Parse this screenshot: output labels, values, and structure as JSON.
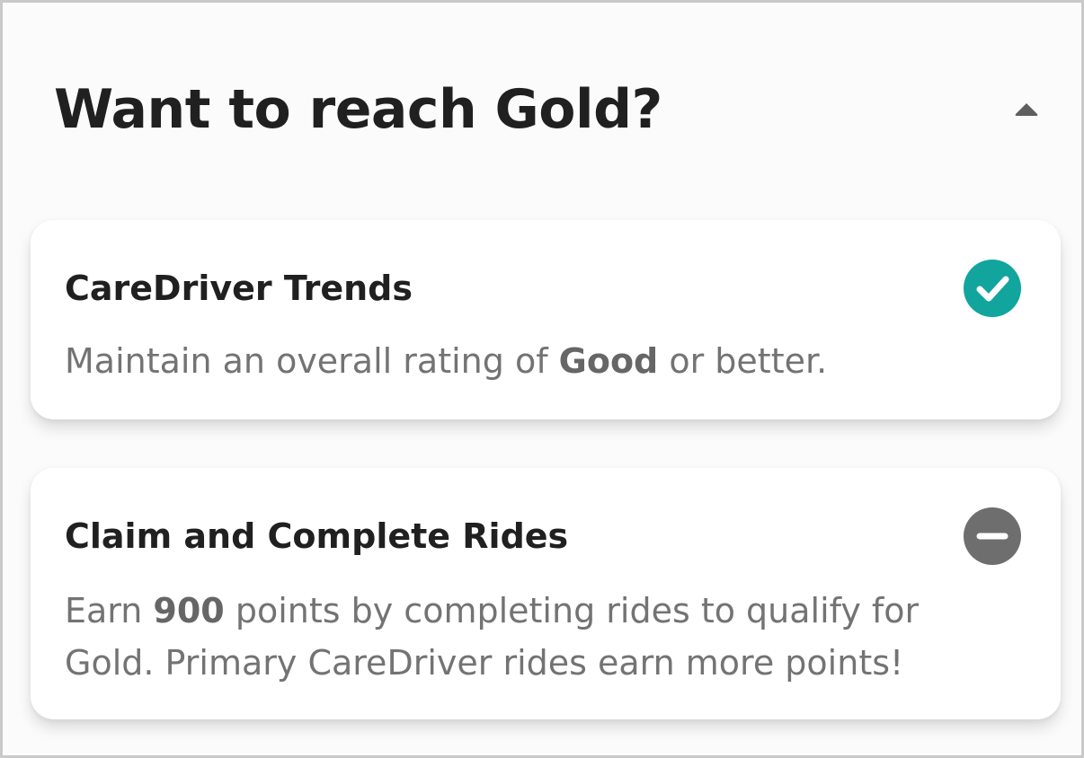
{
  "header": {
    "title": "Want to reach Gold?",
    "toggle_icon": "chevron-up-icon"
  },
  "requirements": [
    {
      "title": "CareDriver Trends",
      "description": {
        "before": "Maintain an overall rating of ",
        "highlight": "Good",
        "after": " or better."
      },
      "status": "complete",
      "status_icon": "check-circle-icon",
      "status_color": "#12a59e"
    },
    {
      "title": "Claim and Complete Rides",
      "description": {
        "before": "Earn ",
        "highlight": "900",
        "after": " points by completing rides to qualify for Gold. Primary CareDriver rides earn more points!"
      },
      "status": "pending",
      "status_icon": "minus-circle-icon",
      "status_color": "#6e6e6e"
    }
  ]
}
